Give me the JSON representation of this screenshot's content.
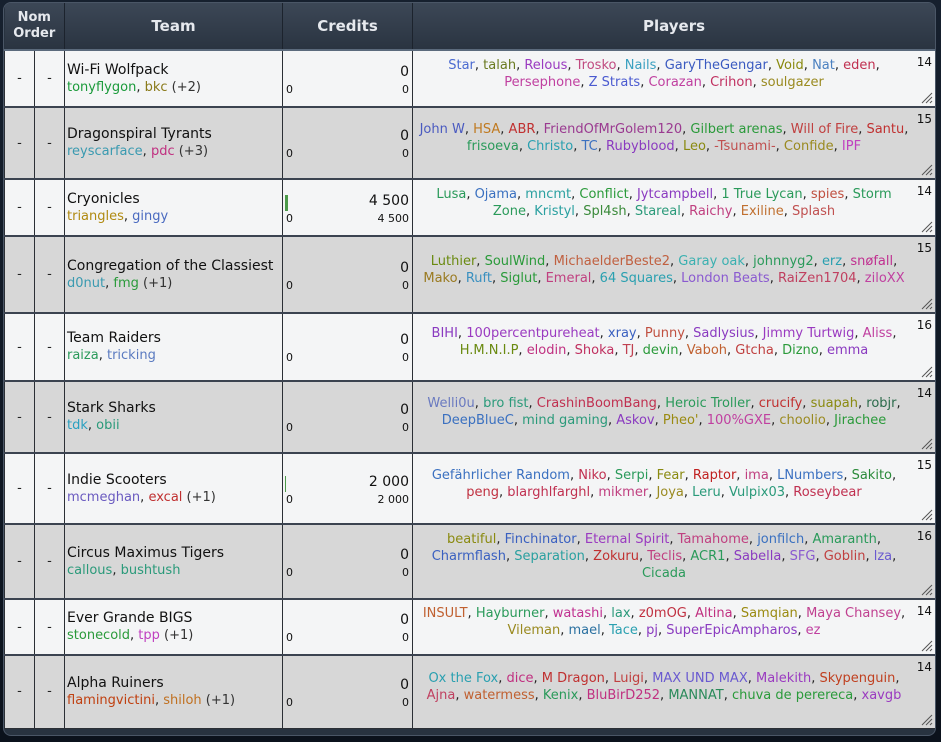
{
  "header": {
    "nom_line1": "Nom",
    "nom_line2": "Order",
    "team": "Team",
    "credits": "Credits",
    "players": "Players"
  },
  "rows": [
    {
      "order": "-",
      "pick": "-",
      "team": "Wi-Fi Wolfpack",
      "managers": [
        {
          "name": "tonyflygon",
          "color": "#1a9a3a"
        },
        {
          "name": "bkc",
          "color": "#8a7a1a"
        }
      ],
      "extra": "(+2)",
      "credits": "0",
      "credits_spent": "0",
      "credits_left": "0",
      "credit_bar": 0,
      "count": "14",
      "players": [
        {
          "n": "Star",
          "c": "#4a6ad0"
        },
        {
          "n": "talah",
          "c": "#6a7a20"
        },
        {
          "n": "Relous",
          "c": "#9a3ac0"
        },
        {
          "n": "Trosko",
          "c": "#c04a80"
        },
        {
          "n": "Nails",
          "c": "#3aa0c0"
        },
        {
          "n": "GaryTheGengar",
          "c": "#3a5ac0"
        },
        {
          "n": "Void",
          "c": "#8a8a10"
        },
        {
          "n": "Nat",
          "c": "#4a80c0"
        },
        {
          "n": "eden",
          "c": "#c03050"
        },
        {
          "n": "Persephone",
          "c": "#c040a0"
        },
        {
          "n": "Z Strats",
          "c": "#4a5ad0"
        },
        {
          "n": "Corazan",
          "c": "#c040a0"
        },
        {
          "n": "Crihon",
          "c": "#c03060"
        },
        {
          "n": "soulgazer",
          "c": "#9a8a20"
        }
      ]
    },
    {
      "order": "-",
      "pick": "-",
      "team": "Dragonspiral Tyrants",
      "managers": [
        {
          "name": "reyscarface",
          "color": "#3a9ab0"
        },
        {
          "name": "pdc",
          "color": "#c03080"
        }
      ],
      "extra": "(+3)",
      "credits": "0",
      "credits_spent": "0",
      "credits_left": "0",
      "credit_bar": 0,
      "count": "15",
      "players": [
        {
          "n": "John W",
          "c": "#4a5ac0"
        },
        {
          "n": "HSA",
          "c": "#c07a20"
        },
        {
          "n": "ABR",
          "c": "#c03030"
        },
        {
          "n": "FriendOfMrGolem120",
          "c": "#9a3a90"
        },
        {
          "n": "Gilbert arenas",
          "c": "#2a9a3a"
        },
        {
          "n": "Will of Fire",
          "c": "#c04040"
        },
        {
          "n": "Santu",
          "c": "#c03030"
        },
        {
          "n": "frisoeva",
          "c": "#2a9a5a"
        },
        {
          "n": "Christo",
          "c": "#2aa0b0"
        },
        {
          "n": "TC",
          "c": "#3a70c0"
        },
        {
          "n": "Rubyblood",
          "c": "#8a3ac0"
        },
        {
          "n": "Leo",
          "c": "#8a8a10"
        },
        {
          "n": "-Tsunami-",
          "c": "#c05050"
        },
        {
          "n": "Confide",
          "c": "#9a8a20"
        },
        {
          "n": "IPF",
          "c": "#c040c0"
        }
      ]
    },
    {
      "order": "-",
      "pick": "-",
      "team": "Cryonicles",
      "managers": [
        {
          "name": "triangles",
          "color": "#b08a10"
        },
        {
          "name": "gingy",
          "color": "#4a6ac0"
        }
      ],
      "extra": "",
      "credits": "4 500",
      "credits_spent": "0",
      "credits_left": "4 500",
      "credit_bar": 0.023,
      "count": "14",
      "players": [
        {
          "n": "Lusa",
          "c": "#2a9a5a"
        },
        {
          "n": "Ojama",
          "c": "#3a70c0"
        },
        {
          "n": "mncmt",
          "c": "#2aa0a0"
        },
        {
          "n": "Conflict",
          "c": "#2a9a3a"
        },
        {
          "n": "Jytcampbell",
          "c": "#8a3ac0"
        },
        {
          "n": "1 True Lycan",
          "c": "#2a9a5a"
        },
        {
          "n": "spies",
          "c": "#c05040"
        },
        {
          "n": "Storm Zone",
          "c": "#2a9a5a"
        },
        {
          "n": "Kristyl",
          "c": "#2aa0a0"
        },
        {
          "n": "Spl4sh",
          "c": "#3a8a3a"
        },
        {
          "n": "Stareal",
          "c": "#2a9a7a"
        },
        {
          "n": "Raichy",
          "c": "#c04080"
        },
        {
          "n": "Exiline",
          "c": "#c07030"
        },
        {
          "n": "Splash",
          "c": "#c05050"
        }
      ]
    },
    {
      "order": "-",
      "pick": "-",
      "team": "Congregation of the Classiest",
      "managers": [
        {
          "name": "d0nut",
          "color": "#3a9ab0"
        },
        {
          "name": "fmg",
          "color": "#2a9a3a"
        }
      ],
      "extra": "(+1)",
      "credits": "0",
      "credits_spent": "0",
      "credits_left": "0",
      "credit_bar": 0,
      "count": "15",
      "players": [
        {
          "n": "Luthier",
          "c": "#6a8a10"
        },
        {
          "n": "SoulWind",
          "c": "#2a9a3a"
        },
        {
          "n": "MichaelderBeste2",
          "c": "#c06040"
        },
        {
          "n": "Garay oak",
          "c": "#3ab0b0"
        },
        {
          "n": "johnnyg2",
          "c": "#2a9a5a"
        },
        {
          "n": "erz",
          "c": "#2aa0b0"
        },
        {
          "n": "snøfall",
          "c": "#c03090"
        },
        {
          "n": "Mako",
          "c": "#9a7a20"
        },
        {
          "n": "Ruft",
          "c": "#3a90c0"
        },
        {
          "n": "Siglut",
          "c": "#2a9a3a"
        },
        {
          "n": "Emeral",
          "c": "#c04080"
        },
        {
          "n": "64 Squares",
          "c": "#2aa0b0"
        },
        {
          "n": "London Beats",
          "c": "#8a5ad0"
        },
        {
          "n": "RaiZen1704",
          "c": "#c04060"
        },
        {
          "n": "ziloXX",
          "c": "#c040a0"
        }
      ]
    },
    {
      "order": "-",
      "pick": "-",
      "team": "Team Raiders",
      "managers": [
        {
          "name": "raiza",
          "color": "#2a9a5a"
        },
        {
          "name": "tricking",
          "color": "#5a7ac0"
        }
      ],
      "extra": "",
      "credits": "0",
      "credits_spent": "0",
      "credits_left": "0",
      "credit_bar": 0,
      "count": "16",
      "players": [
        {
          "n": "BIHI",
          "c": "#8a3ac0"
        },
        {
          "n": "100percentpureheat",
          "c": "#9a3ac0"
        },
        {
          "n": "xray",
          "c": "#3a60c0"
        },
        {
          "n": "Punny",
          "c": "#c05040"
        },
        {
          "n": "Sadlysius",
          "c": "#8a3ac0"
        },
        {
          "n": "Jimmy Turtwig",
          "c": "#9a3ac0"
        },
        {
          "n": "Aliss",
          "c": "#c040a0"
        },
        {
          "n": "H.M.N.I.P",
          "c": "#6a8a10"
        },
        {
          "n": "elodin",
          "c": "#c03080"
        },
        {
          "n": "Shoka",
          "c": "#c03060"
        },
        {
          "n": "TJ",
          "c": "#c04050"
        },
        {
          "n": "devin",
          "c": "#2a9a3a"
        },
        {
          "n": "Vaboh",
          "c": "#c06030"
        },
        {
          "n": "Gtcha",
          "c": "#c04040"
        },
        {
          "n": "Dizno",
          "c": "#2a9a3a"
        },
        {
          "n": "emma",
          "c": "#8a3ac0"
        }
      ]
    },
    {
      "order": "-",
      "pick": "-",
      "team": "Stark Sharks",
      "managers": [
        {
          "name": "tdk",
          "color": "#2aa0c0"
        },
        {
          "name": "obii",
          "color": "#2a9a7a"
        }
      ],
      "extra": "",
      "credits": "0",
      "credits_spent": "0",
      "credits_left": "0",
      "credit_bar": 0,
      "count": "14",
      "players": [
        {
          "n": "Welli0u",
          "c": "#6a7ac0"
        },
        {
          "n": "bro fist",
          "c": "#2a9a7a"
        },
        {
          "n": "CrashinBoomBang",
          "c": "#c03050"
        },
        {
          "n": "Heroic Troller",
          "c": "#2a9a5a"
        },
        {
          "n": "crucify",
          "c": "#c03030"
        },
        {
          "n": "suapah",
          "c": "#8a8a10"
        },
        {
          "n": "robjr",
          "c": "#2a6a4a"
        },
        {
          "n": "DeepBlueC",
          "c": "#3a70c0"
        },
        {
          "n": "mind gaming",
          "c": "#2a9a7a"
        },
        {
          "n": "Askov",
          "c": "#8a3ac0"
        },
        {
          "n": "Pheo'",
          "c": "#9a8a10"
        },
        {
          "n": "100%GXE",
          "c": "#c040a0"
        },
        {
          "n": "choolio",
          "c": "#9a8a20"
        },
        {
          "n": "Jirachee",
          "c": "#2a9a3a"
        }
      ]
    },
    {
      "order": "-",
      "pick": "-",
      "team": "Indie Scooters",
      "managers": [
        {
          "name": "mcmeghan",
          "color": "#6a5ac0"
        },
        {
          "name": "excal",
          "color": "#c03030"
        }
      ],
      "extra": "(+1)",
      "credits": "2 000",
      "credits_spent": "0",
      "credits_left": "2 000",
      "credit_bar": 0.01,
      "count": "15",
      "players": [
        {
          "n": "Gefährlicher Random",
          "c": "#3a70c0"
        },
        {
          "n": "Niko",
          "c": "#c03050"
        },
        {
          "n": "Serpi",
          "c": "#2a9a5a"
        },
        {
          "n": "Fear",
          "c": "#8a8a10"
        },
        {
          "n": "Raptor",
          "c": "#c02020"
        },
        {
          "n": "ima",
          "c": "#c04080"
        },
        {
          "n": "LNumbers",
          "c": "#3a70c0"
        },
        {
          "n": "Sakito",
          "c": "#2a8a3a"
        },
        {
          "n": "peng",
          "c": "#c03040"
        },
        {
          "n": "blarghlfarghl",
          "c": "#c03050"
        },
        {
          "n": "mikmer",
          "c": "#c04080"
        },
        {
          "n": "Joya",
          "c": "#9a8a20"
        },
        {
          "n": "Leru",
          "c": "#2a9a7a"
        },
        {
          "n": "Vulpix03",
          "c": "#2a9a7a"
        },
        {
          "n": "Roseybear",
          "c": "#c03050"
        }
      ]
    },
    {
      "order": "-",
      "pick": "-",
      "team": "Circus Maximus Tigers",
      "managers": [
        {
          "name": "callous",
          "color": "#2a9a7a"
        },
        {
          "name": "bushtush",
          "color": "#2a9a7a"
        }
      ],
      "extra": "",
      "credits": "0",
      "credits_spent": "0",
      "credits_left": "0",
      "credit_bar": 0,
      "count": "16",
      "players": [
        {
          "n": "beatiful",
          "c": "#8a8a10"
        },
        {
          "n": "Finchinator",
          "c": "#3a60c0"
        },
        {
          "n": "Eternal Spirit",
          "c": "#9a3ac0"
        },
        {
          "n": "Tamahome",
          "c": "#c04080"
        },
        {
          "n": "jonfilch",
          "c": "#3a70c0"
        },
        {
          "n": "Amaranth",
          "c": "#2a9a5a"
        },
        {
          "n": "Charmflash",
          "c": "#3a60c0"
        },
        {
          "n": "Separation",
          "c": "#2aa0a0"
        },
        {
          "n": "Zokuru",
          "c": "#c03030"
        },
        {
          "n": "Teclis",
          "c": "#c04080"
        },
        {
          "n": "ACR1",
          "c": "#2a9a5a"
        },
        {
          "n": "Sabella",
          "c": "#8a3ac0"
        },
        {
          "n": "SFG",
          "c": "#8a5ad0"
        },
        {
          "n": "Goblin",
          "c": "#c04040"
        },
        {
          "n": "lza",
          "c": "#6a5ad0"
        },
        {
          "n": "Cicada",
          "c": "#2a9a5a"
        }
      ]
    },
    {
      "order": "-",
      "pick": "-",
      "team": "Ever Grande BIGS",
      "managers": [
        {
          "name": "stonecold",
          "color": "#2a9a3a"
        },
        {
          "name": "tpp",
          "color": "#c040c0"
        }
      ],
      "extra": "(+1)",
      "credits": "0",
      "credits_spent": "0",
      "credits_left": "0",
      "credit_bar": 0,
      "count": "14",
      "players": [
        {
          "n": "INSULT",
          "c": "#c06030"
        },
        {
          "n": "Hayburner",
          "c": "#2a9a5a"
        },
        {
          "n": "watashi",
          "c": "#c03090"
        },
        {
          "n": "lax",
          "c": "#2a9a7a"
        },
        {
          "n": "z0mOG",
          "c": "#c03040"
        },
        {
          "n": "Altina",
          "c": "#c03080"
        },
        {
          "n": "Samqian",
          "c": "#9a8a10"
        },
        {
          "n": "Maya Chansey",
          "c": "#c04090"
        },
        {
          "n": "Vileman",
          "c": "#9a8a20"
        },
        {
          "n": "mael",
          "c": "#2a70a0"
        },
        {
          "n": "Tace",
          "c": "#2aa0b0"
        },
        {
          "n": "pj",
          "c": "#8a3ac0"
        },
        {
          "n": "SuperEpicAmpharos",
          "c": "#8a3ac0"
        },
        {
          "n": "ez",
          "c": "#c040a0"
        }
      ]
    },
    {
      "order": "-",
      "pick": "-",
      "team": "Alpha Ruiners",
      "managers": [
        {
          "name": "flamingvictini",
          "color": "#c04010"
        },
        {
          "name": "shiloh",
          "color": "#c07020"
        }
      ],
      "extra": "(+1)",
      "credits": "0",
      "credits_spent": "0",
      "credits_left": "0",
      "credit_bar": 0,
      "count": "14",
      "players": [
        {
          "n": "Ox the Fox",
          "c": "#2aa0b0"
        },
        {
          "n": "dice",
          "c": "#c03080"
        },
        {
          "n": "M Dragon",
          "c": "#c03030"
        },
        {
          "n": "Luigi",
          "c": "#c04040"
        },
        {
          "n": "MAX UND MAX",
          "c": "#6a5ad0"
        },
        {
          "n": "Malekith",
          "c": "#9a3ac0"
        },
        {
          "n": "Skypenguin",
          "c": "#c04020"
        },
        {
          "n": "Ajna",
          "c": "#c04060"
        },
        {
          "n": "watermess",
          "c": "#c06030"
        },
        {
          "n": "Kenix",
          "c": "#2a9a5a"
        },
        {
          "n": "BluBirD252",
          "c": "#c03080"
        },
        {
          "n": "MANNAT",
          "c": "#2a8a5a"
        },
        {
          "n": "chuva de perereca",
          "c": "#2a9a3a"
        },
        {
          "n": "xavgb",
          "c": "#9a3ac0"
        }
      ]
    }
  ]
}
